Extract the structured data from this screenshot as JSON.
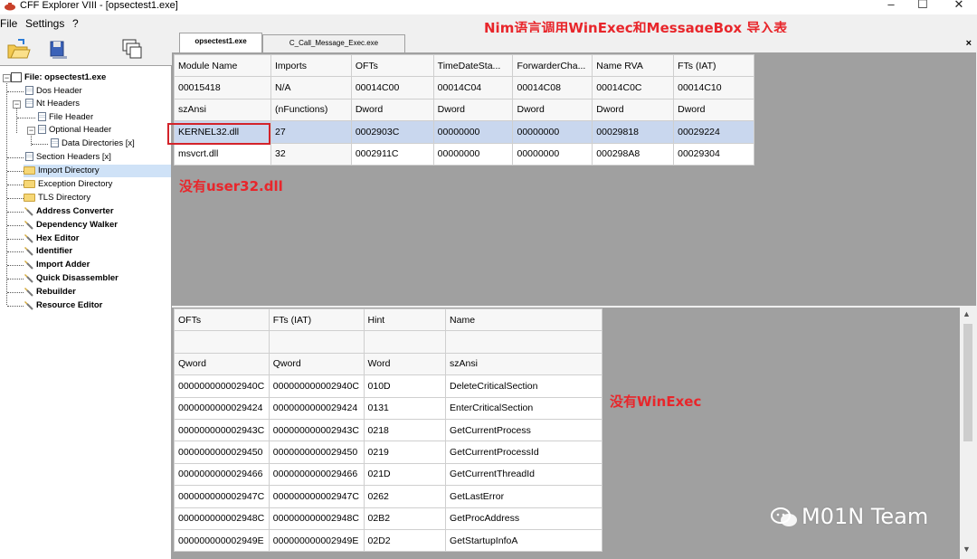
{
  "window": {
    "title": "CFF Explorer VIII - [opsectest1.exe]",
    "minimize": "–",
    "maximize": "☐",
    "close": "✕"
  },
  "overlay_title": "Nim语言调用WinExec和MessageBox 导入表",
  "menu": [
    "File",
    "Settings",
    "?"
  ],
  "toolbar": [
    "open-icon",
    "save-icon",
    "windows-icon"
  ],
  "tree": {
    "items": [
      {
        "label": "File: opsectest1.exe",
        "icon": "file-icon"
      },
      {
        "label": "Dos Header",
        "icon": "doc-icon"
      },
      {
        "label": "Nt Headers",
        "icon": "doc-icon"
      },
      {
        "label": "File Header",
        "icon": "doc-icon"
      },
      {
        "label": "Optional Header",
        "icon": "doc-icon"
      },
      {
        "label": "Data Directories [x]",
        "icon": "doc-icon"
      },
      {
        "label": "Section Headers [x]",
        "icon": "doc-icon"
      },
      {
        "label": "Import Directory",
        "icon": "folder-icon"
      },
      {
        "label": "Exception Directory",
        "icon": "folder-icon"
      },
      {
        "label": "TLS Directory",
        "icon": "folder-icon"
      },
      {
        "label": "Address Converter",
        "icon": "tool-icon"
      },
      {
        "label": "Dependency Walker",
        "icon": "tool-icon"
      },
      {
        "label": "Hex Editor",
        "icon": "tool-icon"
      },
      {
        "label": "Identifier",
        "icon": "tool-icon"
      },
      {
        "label": "Import Adder",
        "icon": "tool-icon"
      },
      {
        "label": "Quick Disassembler",
        "icon": "tool-icon"
      },
      {
        "label": "Rebuilder",
        "icon": "tool-icon"
      },
      {
        "label": "Resource Editor",
        "icon": "tool-icon"
      }
    ]
  },
  "tabs": [
    "opsectest1.exe",
    "C_Call_Message_Exec.exe"
  ],
  "close_tab": "×",
  "modules_table": {
    "headers": [
      "Module Name",
      "Imports",
      "OFTs",
      "TimeDateSta...",
      "ForwarderCha...",
      "Name RVA",
      "FTs (IAT)"
    ],
    "offsets": [
      "00015418",
      "N/A",
      "00014C00",
      "00014C04",
      "00014C08",
      "00014C0C",
      "00014C10"
    ],
    "types": [
      "szAnsi",
      "(nFunctions)",
      "Dword",
      "Dword",
      "Dword",
      "Dword",
      "Dword"
    ],
    "rows": [
      [
        "KERNEL32.dll",
        "27",
        "0002903C",
        "00000000",
        "00000000",
        "00029818",
        "00029224"
      ],
      [
        "msvcrt.dll",
        "32",
        "0002911C",
        "00000000",
        "00000000",
        "000298A8",
        "00029304"
      ]
    ]
  },
  "annotation_user32": "没有user32.dll",
  "functions_table": {
    "headers": [
      "OFTs",
      "FTs (IAT)",
      "Hint",
      "Name"
    ],
    "types": [
      "Qword",
      "Qword",
      "Word",
      "szAnsi"
    ],
    "rows": [
      [
        "000000000002940C",
        "000000000002940C",
        "010D",
        "DeleteCriticalSection"
      ],
      [
        "0000000000029424",
        "0000000000029424",
        "0131",
        "EnterCriticalSection"
      ],
      [
        "000000000002943C",
        "000000000002943C",
        "0218",
        "GetCurrentProcess"
      ],
      [
        "0000000000029450",
        "0000000000029450",
        "0219",
        "GetCurrentProcessId"
      ],
      [
        "0000000000029466",
        "0000000000029466",
        "021D",
        "GetCurrentThreadId"
      ],
      [
        "000000000002947C",
        "000000000002947C",
        "0262",
        "GetLastError"
      ],
      [
        "000000000002948C",
        "000000000002948C",
        "02B2",
        "GetProcAddress"
      ],
      [
        "000000000002949E",
        "000000000002949E",
        "02D2",
        "GetStartupInfoA"
      ]
    ]
  },
  "annotation_winexec": "没有WinExec",
  "watermark": "M01N Team"
}
